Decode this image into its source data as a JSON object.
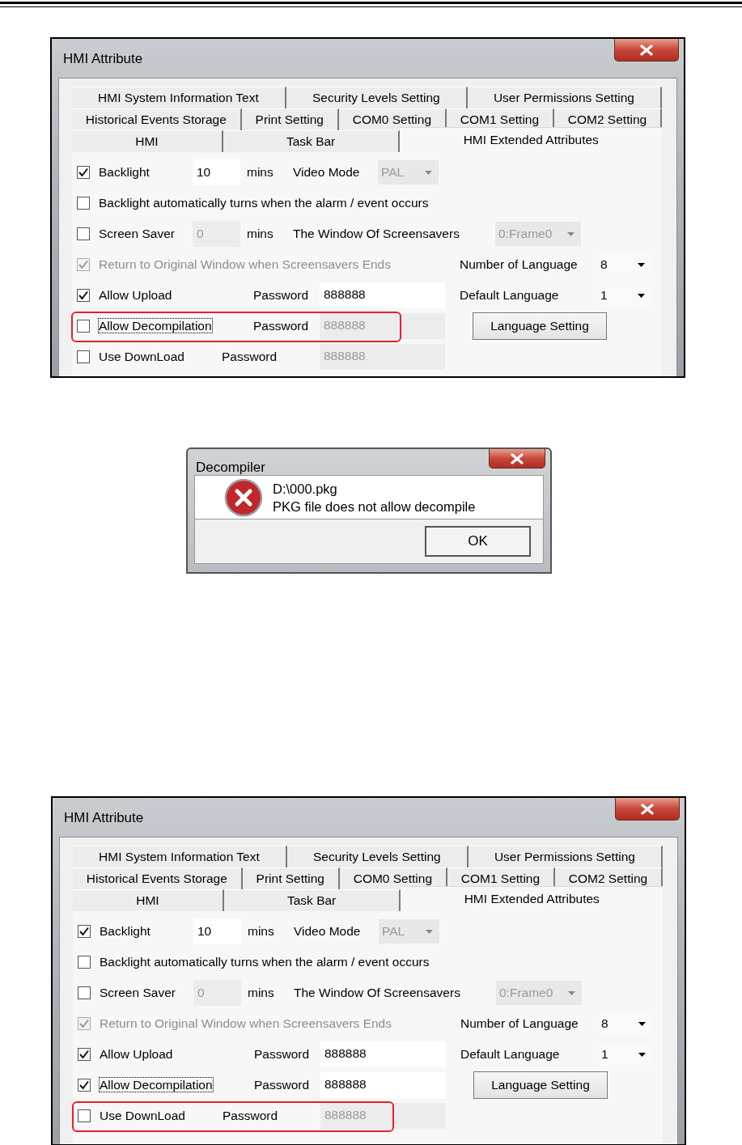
{
  "figures": [
    {
      "kind": "hmi_attribute",
      "title": "HMI Attribute",
      "tab_rows": [
        [
          {
            "label": "HMI System Information Text",
            "selected": false
          },
          {
            "label": "Security Levels Setting",
            "selected": false
          },
          {
            "label": "User Permissions Setting",
            "selected": false
          }
        ],
        [
          {
            "label": "Historical Events Storage",
            "selected": false
          },
          {
            "label": "Print Setting",
            "selected": false
          },
          {
            "label": "COM0 Setting",
            "selected": false
          },
          {
            "label": "COM1 Setting",
            "selected": false
          },
          {
            "label": "COM2 Setting",
            "selected": false
          }
        ],
        [
          {
            "label": "HMI",
            "selected": false
          },
          {
            "label": "Task Bar",
            "selected": false
          },
          {
            "label": "HMI Extended Attributes",
            "selected": true
          }
        ]
      ],
      "backlight": {
        "label": "Backlight",
        "checked": true,
        "value": "10",
        "unit": "mins"
      },
      "video_mode": {
        "label": "Video Mode",
        "value": "PAL"
      },
      "auto_backlight": {
        "label": "Backlight automatically turns when the alarm / event occurs",
        "checked": false
      },
      "screen_saver": {
        "label": "Screen Saver",
        "checked": false,
        "value": "0",
        "unit": "mins"
      },
      "screensaver_window": {
        "label": "The Window Of Screensavers",
        "value": "0:Frame0"
      },
      "return_to_original": {
        "label": "Return to Original Window when Screensavers Ends",
        "checked": true,
        "disabled": true
      },
      "number_of_language": {
        "label": "Number of Language",
        "value": "8"
      },
      "default_language": {
        "label": "Default Language",
        "value": "1"
      },
      "language_button": "Language Setting",
      "password_rows": [
        {
          "label": "Allow Upload",
          "checked": true,
          "focused": false,
          "highlighted": false,
          "password_label": "Password",
          "password": "888888"
        },
        {
          "label": "Allow Decompilation",
          "checked": false,
          "focused": true,
          "highlighted": true,
          "password_label": "Password",
          "password": "888888"
        },
        {
          "label": "Use DownLoad",
          "checked": false,
          "focused": false,
          "highlighted": false,
          "password_label": "Password",
          "password": "888888"
        }
      ]
    },
    {
      "kind": "message_box",
      "title": "Decompiler",
      "lines": [
        "D:\\000.pkg",
        "PKG file does not allow decompile"
      ],
      "button": "OK"
    },
    {
      "kind": "hmi_attribute",
      "title": "HMI Attribute",
      "tab_rows": [
        [
          {
            "label": "HMI System Information Text",
            "selected": false
          },
          {
            "label": "Security Levels Setting",
            "selected": false
          },
          {
            "label": "User Permissions Setting",
            "selected": false
          }
        ],
        [
          {
            "label": "Historical Events Storage",
            "selected": false
          },
          {
            "label": "Print Setting",
            "selected": false
          },
          {
            "label": "COM0 Setting",
            "selected": false
          },
          {
            "label": "COM1 Setting",
            "selected": false
          },
          {
            "label": "COM2 Setting",
            "selected": false
          }
        ],
        [
          {
            "label": "HMI",
            "selected": false
          },
          {
            "label": "Task Bar",
            "selected": false
          },
          {
            "label": "HMI Extended Attributes",
            "selected": true
          }
        ]
      ],
      "backlight": {
        "label": "Backlight",
        "checked": true,
        "value": "10",
        "unit": "mins"
      },
      "video_mode": {
        "label": "Video Mode",
        "value": "PAL"
      },
      "auto_backlight": {
        "label": "Backlight automatically turns when the alarm / event occurs",
        "checked": false
      },
      "screen_saver": {
        "label": "Screen Saver",
        "checked": false,
        "value": "0",
        "unit": "mins"
      },
      "screensaver_window": {
        "label": "The Window Of Screensavers",
        "value": "0:Frame0"
      },
      "return_to_original": {
        "label": "Return to Original Window when Screensavers Ends",
        "checked": true,
        "disabled": true
      },
      "number_of_language": {
        "label": "Number of Language",
        "value": "8"
      },
      "default_language": {
        "label": "Default Language",
        "value": "1"
      },
      "language_button": "Language Setting",
      "password_rows": [
        {
          "label": "Allow Upload",
          "checked": true,
          "focused": false,
          "highlighted": false,
          "password_label": "Password",
          "password": "888888"
        },
        {
          "label": "Allow Decompilation",
          "checked": true,
          "focused": true,
          "highlighted": false,
          "password_label": "Password",
          "password": "888888"
        },
        {
          "label": "Use DownLoad",
          "checked": false,
          "focused": false,
          "highlighted": true,
          "password_label": "Password",
          "password": "888888"
        }
      ]
    }
  ]
}
